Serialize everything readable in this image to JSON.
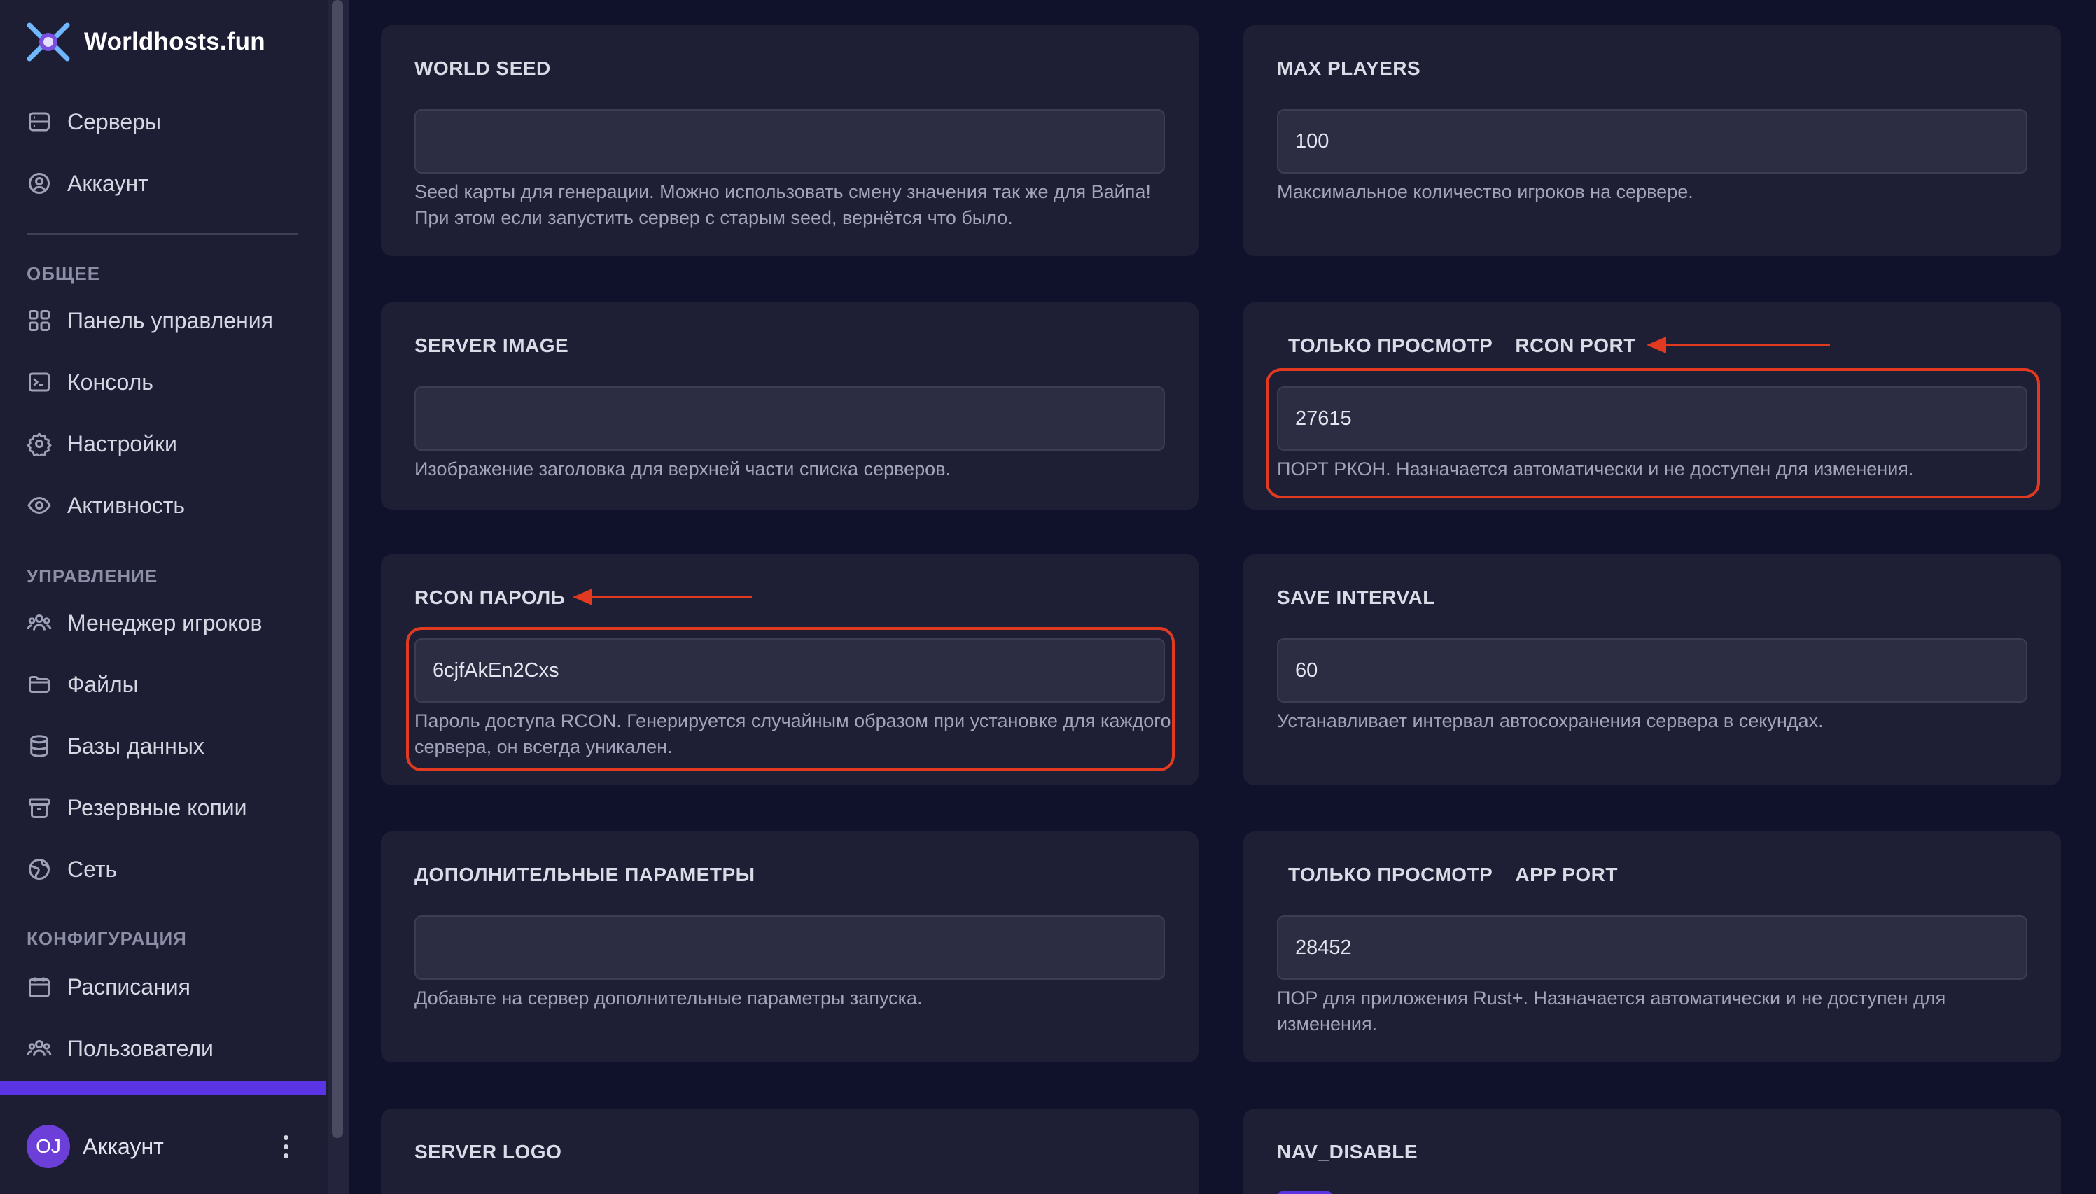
{
  "brand": {
    "name": "Worldhosts.fun"
  },
  "nav": {
    "servers": "Серверы",
    "account": "Аккаунт",
    "section_general": "ОБЩЕЕ",
    "dashboard": "Панель управления",
    "console": "Консоль",
    "settings": "Настройки",
    "activity": "Активность",
    "section_manage": "УПРАВЛЕНИЕ",
    "players": "Менеджер игроков",
    "files": "Файлы",
    "databases": "Базы данных",
    "backups": "Резервные копии",
    "network": "Сеть",
    "section_config": "КОНФИГУРАЦИЯ",
    "schedules": "Расписания",
    "users": "Пользователи"
  },
  "account": {
    "initials": "OJ",
    "name": "Аккаунт"
  },
  "fields": {
    "world_seed": {
      "label": "WORLD SEED",
      "value": "",
      "help": "Seed карты для генерации. Можно использовать смену значения так же для Вайпа! При этом если запустить сервер с старым seed, вернётся что было."
    },
    "max_players": {
      "label": "MAX PLAYERS",
      "value": "100",
      "help": "Максимальное количество игроков на сервере."
    },
    "server_image": {
      "label": "SERVER IMAGE",
      "value": "",
      "help": "Изображение заголовка для верхней части списка серверов."
    },
    "rcon_port": {
      "readonly_tag": "ТОЛЬКО ПРОСМОТР",
      "label": "RCON PORT",
      "value": "27615",
      "help": "ПОРТ РКОН. Назначается автоматически и не доступен для изменения."
    },
    "rcon_password": {
      "label": "RCON ПАРОЛЬ",
      "value": "6cjfAkEn2Cxs",
      "help": "Пароль доступа RCON. Генерируется случайным образом при установке для каждого сервера, он всегда уникален."
    },
    "save_interval": {
      "label": "SAVE INTERVAL",
      "value": "60",
      "help": "Устанавливает интервал автосохранения сервера в секундах."
    },
    "extra_params": {
      "label": "ДОПОЛНИТЕЛЬНЫЕ ПАРАМЕТРЫ",
      "value": "",
      "help": "Добавьте на сервер дополнительные параметры запуска."
    },
    "app_port": {
      "readonly_tag": "ТОЛЬКО ПРОСМОТР",
      "label": "APP PORT",
      "value": "28452",
      "help": "ПОР для приложения Rust+. Назначается автоматически и не доступен для изменения."
    },
    "server_logo": {
      "label": "SERVER LOGO"
    },
    "nav_disable": {
      "label": "NAV_DISABLE"
    }
  },
  "colors": {
    "background": "#10112a",
    "sidebar": "#1d1e34",
    "card": "#1e1f35",
    "accent": "#5b34e6",
    "annotation": "#e23a20"
  }
}
